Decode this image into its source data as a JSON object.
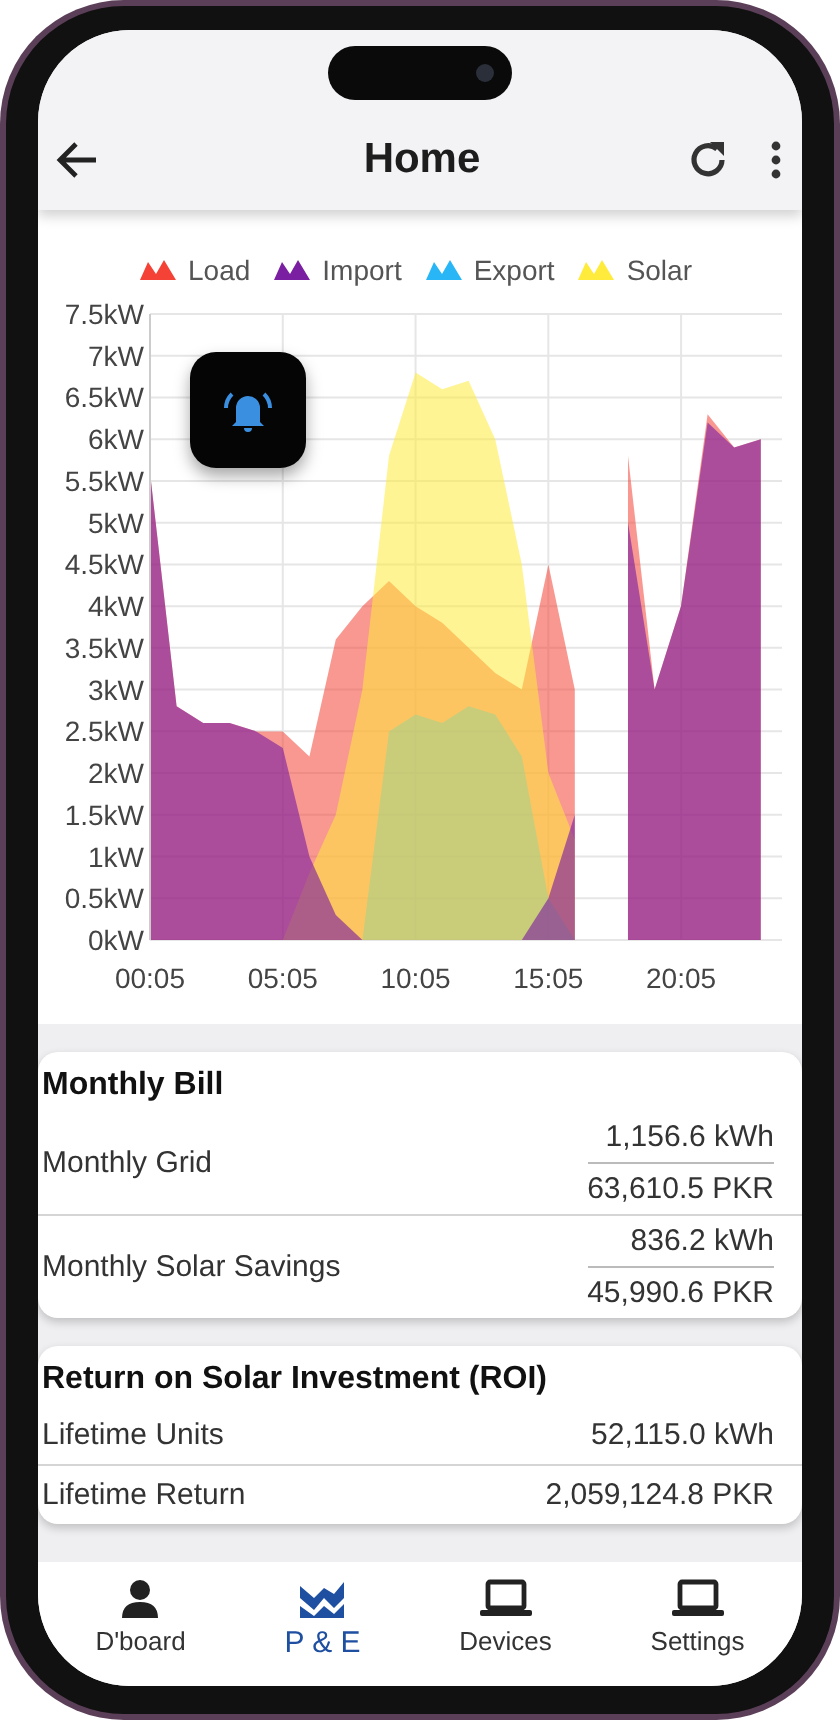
{
  "header": {
    "title": "Home"
  },
  "chart": {
    "chart_data": {
      "type": "area",
      "categories": [
        "00:05",
        null,
        null,
        null,
        null,
        "05:05",
        null,
        null,
        null,
        null,
        "10:05",
        null,
        null,
        null,
        null,
        "15:05",
        null,
        null,
        null,
        null,
        "20:05",
        null,
        null,
        null
      ],
      "ylim": [
        0,
        7.5
      ],
      "grid": true,
      "yticks": [
        {
          "value": 0,
          "label": "0kW"
        },
        {
          "value": 0.5,
          "label": "0.5kW"
        },
        {
          "value": 1,
          "label": "1kW"
        },
        {
          "value": 1.5,
          "label": "1.5kW"
        },
        {
          "value": 2,
          "label": "2kW"
        },
        {
          "value": 2.5,
          "label": "2.5kW"
        },
        {
          "value": 3,
          "label": "3kW"
        },
        {
          "value": 3.5,
          "label": "3.5kW"
        },
        {
          "value": 4,
          "label": "4kW"
        },
        {
          "value": 4.5,
          "label": "4.5kW"
        },
        {
          "value": 5,
          "label": "5kW"
        },
        {
          "value": 5.5,
          "label": "5.5kW"
        },
        {
          "value": 6,
          "label": "6kW"
        },
        {
          "value": 6.5,
          "label": "6.5kW"
        },
        {
          "value": 7,
          "label": "7kW"
        },
        {
          "value": 7.5,
          "label": "7.5kW"
        }
      ],
      "series": [
        {
          "name": "Load",
          "color": "#f44336",
          "values": [
            5.6,
            2.8,
            2.6,
            2.6,
            2.5,
            2.5,
            2.2,
            3.6,
            4.0,
            4.3,
            4.0,
            3.8,
            3.5,
            3.2,
            3.0,
            4.5,
            3.0,
            null,
            5.8,
            3.0,
            4.0,
            6.3,
            5.9,
            6.0
          ]
        },
        {
          "name": "Import",
          "color": "#7b1fa2",
          "values": [
            5.6,
            2.8,
            2.6,
            2.6,
            2.5,
            2.3,
            1.0,
            0.3,
            0,
            null,
            null,
            null,
            null,
            null,
            0,
            0.5,
            1.5,
            null,
            5.0,
            3.0,
            4.0,
            6.2,
            5.9,
            6.0
          ]
        },
        {
          "name": "Export",
          "color": "#29b6f6",
          "values": [
            0,
            0,
            0,
            0,
            0,
            0,
            0,
            0,
            0,
            2.5,
            2.7,
            2.6,
            2.8,
            2.7,
            2.2,
            0.5,
            0,
            null,
            null,
            null,
            null,
            null,
            null,
            null
          ]
        },
        {
          "name": "Solar",
          "color": "#ffeb3b",
          "values": [
            0,
            0,
            0,
            0,
            0,
            0,
            0.8,
            1.5,
            3.0,
            5.8,
            6.8,
            6.6,
            6.7,
            6.0,
            4.5,
            2.0,
            1.2,
            null,
            null,
            null,
            null,
            null,
            null,
            null
          ]
        }
      ]
    }
  },
  "monthly_bill": {
    "title": "Monthly Bill",
    "rows": [
      {
        "label": "Monthly Grid",
        "energy": "1,156.6 kWh",
        "cost": "63,610.5 PKR"
      },
      {
        "label": "Monthly Solar Savings",
        "energy": "836.2 kWh",
        "cost": "45,990.6 PKR"
      }
    ]
  },
  "roi": {
    "title": "Return on Solar Investment (ROI)",
    "rows": [
      {
        "label": "Lifetime Units",
        "value": "52,115.0 kWh"
      },
      {
        "label": "Lifetime Return",
        "value": "2,059,124.8 PKR"
      }
    ]
  },
  "nav": [
    {
      "label": "D'board",
      "selected": false
    },
    {
      "label": "P & E",
      "selected": true
    },
    {
      "label": "Devices",
      "selected": false
    },
    {
      "label": "Settings",
      "selected": false
    }
  ]
}
